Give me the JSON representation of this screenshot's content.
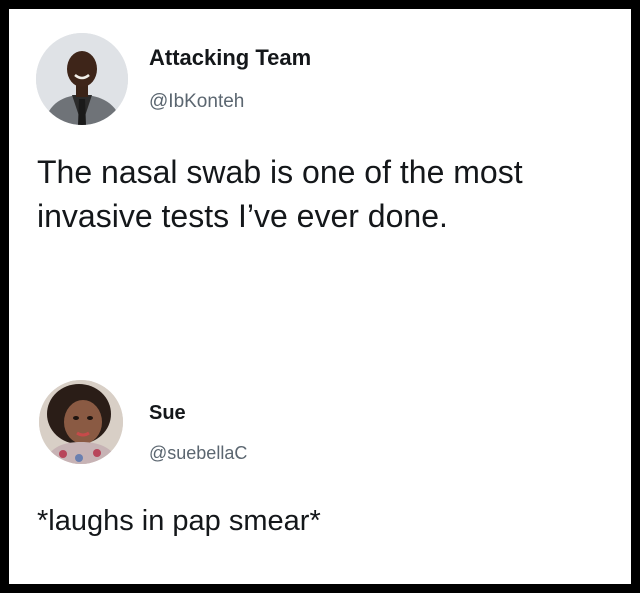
{
  "tweets": [
    {
      "display_name": "Attacking Team",
      "handle": "@IbKonteh",
      "text_lines": [
        "The nasal swab is one of the most",
        "invasive tests I’ve ever done."
      ],
      "avatar_icon": "profile-photo-man-in-suit"
    },
    {
      "display_name": "Sue",
      "handle": "@suebellaC",
      "text_lines": [
        "*laughs in pap smear*"
      ],
      "avatar_icon": "profile-photo-woman"
    }
  ],
  "colors": {
    "border": "#000000",
    "background": "#ffffff",
    "text": "#14171a",
    "handle": "#5b6670"
  }
}
